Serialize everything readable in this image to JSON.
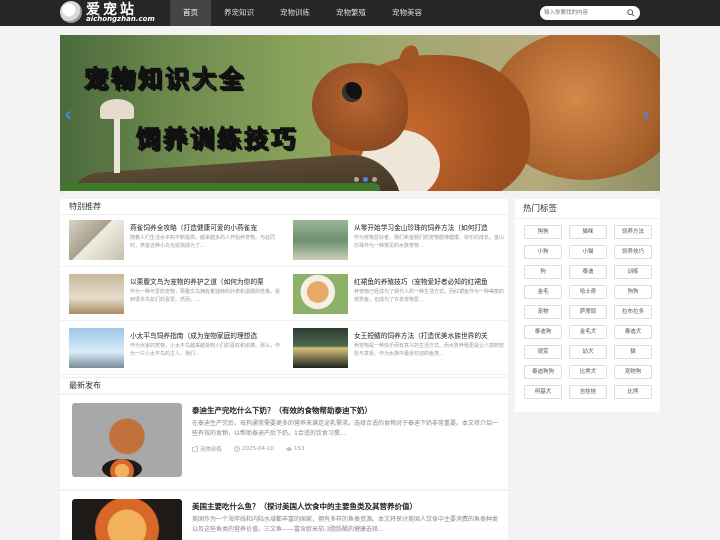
{
  "header": {
    "brand": "爱宠站",
    "domain": "aichongzhan.com",
    "nav": [
      "首页",
      "养宠知识",
      "宠物训练",
      "宠物繁殖",
      "宠物美容"
    ],
    "active_index": 0,
    "search_placeholder": "输入你要找的内容"
  },
  "banner": {
    "line1": "宠物知识大全",
    "line2": "饲养训练技巧",
    "slide_count": 3,
    "active_slide": 1
  },
  "featured": {
    "title": "特别推荐",
    "items": [
      {
        "title": "燕雀饲养全攻略（打造健康可爱的小燕雀宠",
        "desc": "随着人们生活水平的不断提高，越来越多的人开始养宠物。与此同时，燕雀这种小鸟也逐渐成为了..."
      },
      {
        "title": "从零开始学习金山珍珠的饲养方法（如何打造",
        "desc": "作为宠物爱好者，我们希望我们的宠物能够健康、快乐的成长。金山珍珠作为一种常见的水族宠物..."
      },
      {
        "title": "以栗腹文鸟为宠物的养护之道（如何为你的栗",
        "desc": "作为一种可爱的宠物，栗腹文鸟拥有着独特的外表和温顺的性格，受到很多鸟友们的喜爱。然而，..."
      },
      {
        "title": "红裙鱼的养殖技巧（宠物爱好者必知的红裙鱼",
        "desc": "养宠物已经成为了现代人的一种生活方式，而红裙鱼作为一种美丽的观赏鱼，也成为了许多宠物爱..."
      },
      {
        "title": "小太平鸟饲养指南（成为宠物家庭的理想选",
        "desc": "作为大家的宠物，小太平鸟越来越受到人们的喜欢和追捧。那么，作为一只小太平鸟的主人，我们..."
      },
      {
        "title": "女王短鳍的饲养方法（打造优美水族世界的关",
        "desc": "养宠物是一种快乐而有意义的生活方式。而水族养殖更是让人感到放松与享受。作为水族中最受欢迎的鱼类..."
      }
    ]
  },
  "latest": {
    "title": "最新发布",
    "posts": [
      {
        "title": "泰迪生产完吃什么下奶？（有效的食物帮助泰迪下奶）",
        "desc": "在泰迪生产完后，母狗通常需要更多的营养来满足泌乳需求。选择合适的食物对于泰迪下奶非常重要。本文将介绍一些有效的食物，以帮助泰迪产后下奶。1合适的饮食习惯...",
        "category": "宠物训练",
        "date": "2025-04-10",
        "views": "153"
      },
      {
        "title": "美国主要吃什么鱼？（探讨美国人饮食中的主要鱼类及其营养价值）",
        "desc": "美国作为一个海岸线和内陆水域都丰富的国家，拥有多样的鱼类资源。本文将探讨美国人饮食中主要消费的鱼类种类以及这些鱼类的营养价值。三文鱼——富含欧米茄-3脂肪酸的健康选择...",
        "category": "",
        "date": "",
        "views": ""
      }
    ]
  },
  "tags": {
    "title": "热门标签",
    "items": [
      "狗狗",
      "猫咪",
      "饲养方法",
      "小狗",
      "小猫",
      "饲养技巧",
      "狗",
      "泰迪",
      "训练",
      "金毛",
      "哈士奇",
      "狗狗",
      "宠物",
      "萨摩耶",
      "拉布拉多",
      "泰迪狗",
      "金毛犬",
      "泰迪犬",
      "观赏",
      "幼犬",
      "猫",
      "泰迪狗狗",
      "比熊犬",
      "宠物狗",
      "柯基犬",
      "吉娃娃",
      "比熊"
    ]
  },
  "icons": {
    "search": "search-icon",
    "category": "folder-icon",
    "date": "clock-icon",
    "views": "eye-icon"
  },
  "colors": {
    "header_bg": "#262626",
    "accent": "#4a89d8"
  }
}
